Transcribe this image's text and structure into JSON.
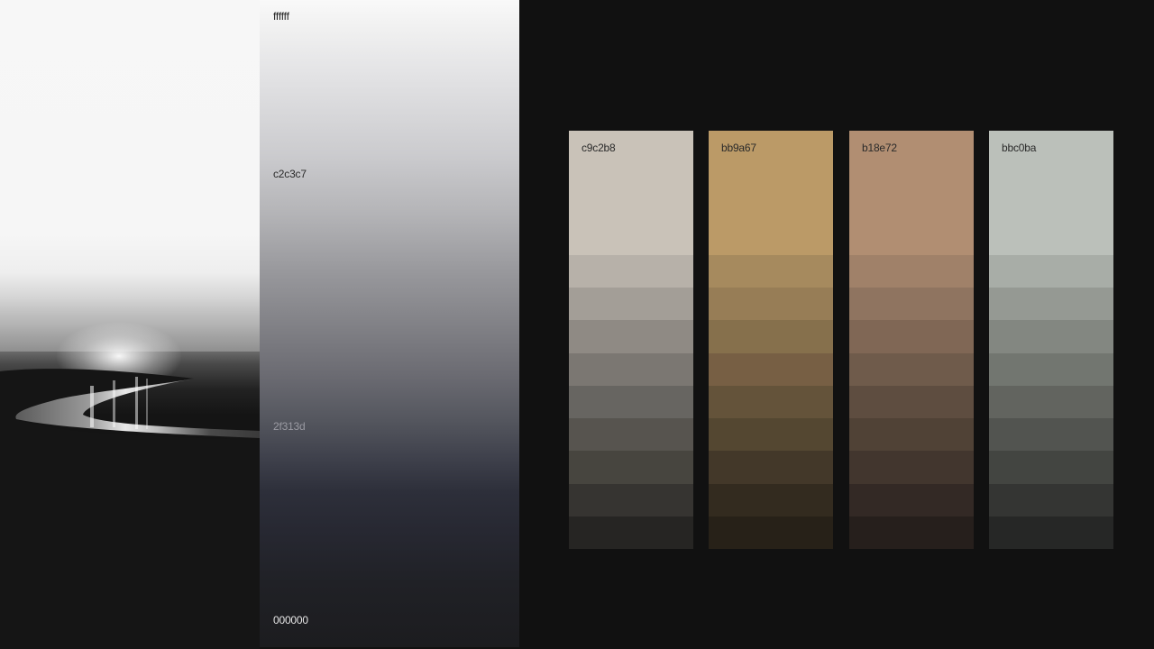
{
  "gradient_strip": {
    "labels": [
      {
        "text": "ffffff",
        "color": "#222222"
      },
      {
        "text": "c2c3c7",
        "color": "#2a2a2a"
      },
      {
        "text": "2f313d",
        "color": "#9a9aa2"
      },
      {
        "text": "000000",
        "color": "#e6e6e6"
      }
    ]
  },
  "swatches": [
    {
      "code": "c9c2b8",
      "base": "#c9c2b8",
      "shades": [
        "#b7b1a9",
        "#a39e97",
        "#8f8a84",
        "#7b7772",
        "#676561",
        "#57544f",
        "#47453f",
        "#363431",
        "#262523"
      ]
    },
    {
      "code": "bb9a67",
      "base": "#bb9a67",
      "shades": [
        "#a68a5e",
        "#977d56",
        "#86704c",
        "#775f44",
        "#64533a",
        "#544731",
        "#433829",
        "#332b1f",
        "#272118"
      ]
    },
    {
      "code": "b18e72",
      "base": "#b18e72",
      "shades": [
        "#a08169",
        "#8f7460",
        "#806755",
        "#6f5b4b",
        "#5e4d40",
        "#504236",
        "#42362e",
        "#332925",
        "#261f1c"
      ]
    },
    {
      "code": "bbc0ba",
      "base": "#bbc0ba",
      "shades": [
        "#a8ada7",
        "#959993",
        "#838781",
        "#727670",
        "#62645f",
        "#525450",
        "#434541",
        "#343533",
        "#262726"
      ]
    }
  ]
}
